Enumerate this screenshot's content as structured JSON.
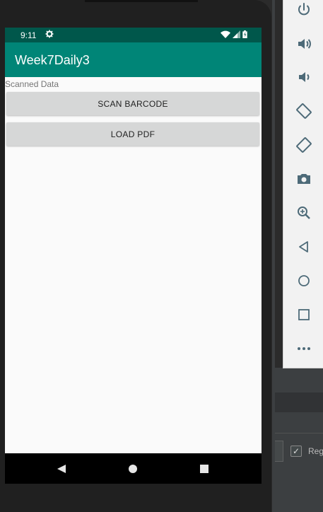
{
  "status_bar": {
    "time": "9:11",
    "settings_icon": "gear-icon",
    "wifi_icon": "wifi-icon",
    "signal_icon": "signal-icon",
    "battery_icon": "battery-icon"
  },
  "app": {
    "title": "Week7Daily3",
    "primary_color": "#008577",
    "primary_dark": "#00574b"
  },
  "content": {
    "scanned_label": "Scanned Data",
    "scan_button": "SCAN BARCODE",
    "load_pdf_button": "LOAD PDF"
  },
  "nav_bar": {
    "back_icon": "back-triangle-icon",
    "home_icon": "home-circle-icon",
    "recents_icon": "recents-square-icon"
  },
  "emulator_toolbar": {
    "items": [
      {
        "icon": "power-icon"
      },
      {
        "icon": "volume-up-icon"
      },
      {
        "icon": "volume-down-icon"
      },
      {
        "icon": "rotate-left-icon"
      },
      {
        "icon": "rotate-right-icon"
      },
      {
        "icon": "camera-icon"
      },
      {
        "icon": "zoom-icon"
      },
      {
        "icon": "back-icon"
      },
      {
        "icon": "home-icon"
      },
      {
        "icon": "overview-icon"
      },
      {
        "icon": "more-icon"
      }
    ]
  },
  "ide": {
    "checkbox_checked": true,
    "checkbox_label": "Reg"
  }
}
